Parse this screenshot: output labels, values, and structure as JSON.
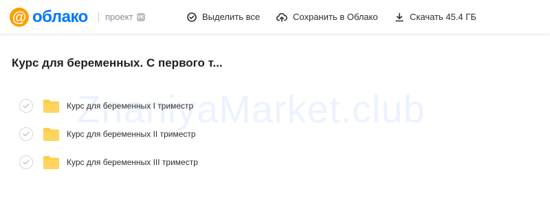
{
  "header": {
    "logo_symbol": "@",
    "logo_text": "облако",
    "project_label": "проект",
    "project_badge": "VK",
    "toolbar": {
      "select_all_label": "Выделить все",
      "save_label": "Сохранить в Облако",
      "download_label": "Скачать 45.4 ГБ"
    }
  },
  "main": {
    "title": "Курс для беременных. С первого т...",
    "files": [
      {
        "name": "Курс для беременных I триместр",
        "icon": "folder-icon"
      },
      {
        "name": "Курс для беременных II триместр",
        "icon": "folder-icon"
      },
      {
        "name": "Курс для беременных III триместр",
        "icon": "folder-icon"
      }
    ]
  },
  "watermark": "ZnaniyaMarket.club",
  "colors": {
    "brand_orange": "#ff9e00",
    "brand_blue": "#0077ff",
    "folder_yellow": "#ffcc48",
    "text_dark": "#2c2d2e",
    "muted": "#8c8c8c"
  }
}
